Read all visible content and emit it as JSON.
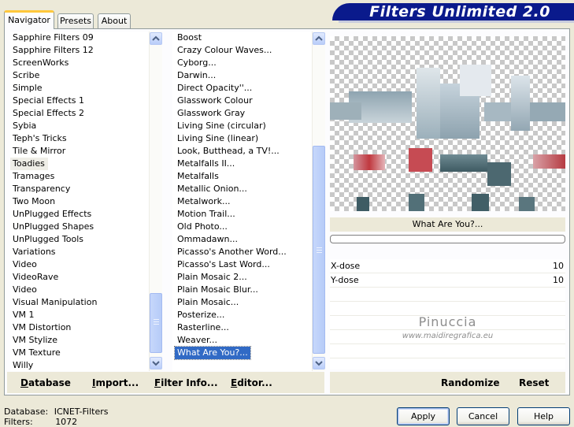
{
  "tabs": [
    {
      "label": "Navigator",
      "active": true
    },
    {
      "label": "Presets",
      "active": false
    },
    {
      "label": "About",
      "active": false
    }
  ],
  "app_title": "Filters Unlimited 2.0",
  "categories": {
    "items": [
      "Sapphire Filters 09",
      "Sapphire Filters 12",
      "ScreenWorks",
      "Scribe",
      "Simple",
      "Special Effects 1",
      "Special Effects 2",
      "Sybia",
      "Teph's Tricks",
      "Tile & Mirror",
      "Toadies",
      "Tramages",
      "Transparency",
      "Two Moon",
      "UnPlugged Effects",
      "UnPlugged Shapes",
      "UnPlugged Tools",
      "Variations",
      "Video",
      "VideoRave",
      "Video",
      "Visual Manipulation",
      "VM 1",
      "VM Distortion",
      "VM Stylize",
      "VM Texture",
      "Willy"
    ],
    "selected_index": 10
  },
  "filters": {
    "items": [
      "Boost",
      "Crazy Colour Waves...",
      "Cyborg...",
      "Darwin...",
      "Direct Opacity''...",
      "Glasswork Colour",
      "Glasswork Gray",
      "Living Sine (circular)",
      "Living Sine (linear)",
      "Look, Butthead, a TV!...",
      "Metalfalls II...",
      "Metalfalls",
      "Metallic Onion...",
      "Metalwork...",
      "Motion Trail...",
      "Old Photo...",
      "Ommadawn...",
      "Picasso's Another Word...",
      "Picasso's Last Word...",
      "Plain Mosaic 2...",
      "Plain Mosaic Blur...",
      "Plain Mosaic...",
      "Posterize...",
      "Rasterline...",
      "Weaver...",
      "What Are You?..."
    ],
    "selected_index": 25
  },
  "current_filter": "What Are You?...",
  "progress": 0,
  "params": [
    {
      "label": "X-dose",
      "value": "10"
    },
    {
      "label": "Y-dose",
      "value": "10"
    }
  ],
  "watermark": {
    "name": "Pinuccia",
    "url": "www.maidiregrafica.eu"
  },
  "commands": {
    "database": "Database",
    "import": "Import...",
    "filter_info": "Filter Info...",
    "editor": "Editor...",
    "randomize": "Randomize",
    "reset": "Reset"
  },
  "status": {
    "database_label": "Database:",
    "database_value": "ICNET-Filters",
    "filters_label": "Filters:",
    "filters_value": "1072"
  },
  "buttons": {
    "apply": "Apply",
    "cancel": "Cancel",
    "help": "Help"
  },
  "colors": {
    "banner": "#0a1a8c",
    "selection": "#316ac5",
    "tab_highlight": "#ffc83c"
  }
}
